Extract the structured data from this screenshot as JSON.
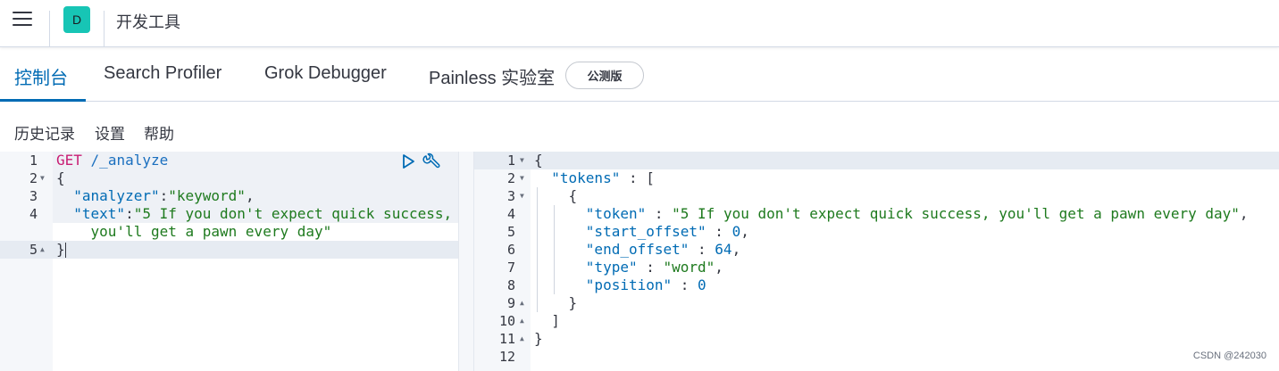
{
  "header": {
    "avatar_letter": "D",
    "title": "开发工具"
  },
  "tabs": [
    {
      "label": "控制台",
      "selected": true
    },
    {
      "label": "Search Profiler",
      "selected": false
    },
    {
      "label": "Grok Debugger",
      "selected": false
    },
    {
      "label": "Painless 实验室",
      "selected": false
    }
  ],
  "beta_badge": "公测版",
  "topnav": {
    "history": "历史记录",
    "settings": "设置",
    "help": "帮助"
  },
  "request_editor": {
    "line_numbers": [
      "1",
      "2",
      "3",
      "4",
      "5"
    ],
    "method": "GET",
    "url": "/_analyze",
    "open_brace": "{",
    "analyzer_key": "\"analyzer\"",
    "analyzer_value": "\"keyword\"",
    "text_key": "\"text\"",
    "text_value_line1": "\"5 If you don't expect quick success,",
    "text_value_line2": "you'll get a pawn every day\"",
    "close_brace": "}"
  },
  "response_editor": {
    "line_numbers": [
      "1",
      "2",
      "3",
      "4",
      "5",
      "6",
      "7",
      "8",
      "9",
      "10",
      "11",
      "12"
    ],
    "tokens_key": "\"tokens\"",
    "token_key": "\"token\"",
    "token_value": "\"5 If you don't expect quick success, you'll get a pawn every day\"",
    "start_offset_key": "\"start_offset\"",
    "start_offset_value": "0",
    "end_offset_key": "\"end_offset\"",
    "end_offset_value": "64",
    "type_key": "\"type\"",
    "type_value": "\"word\"",
    "position_key": "\"position\"",
    "position_value": "0"
  },
  "watermark": "CSDN @242030",
  "icons": [
    "menu-icon",
    "play-icon",
    "wrench-icon",
    "fold-arrow-icon"
  ],
  "colors": {
    "accent": "#006bb4",
    "avatar_bg": "#17c5b5",
    "method": "#c91d73",
    "string": "#1e7a1e"
  }
}
